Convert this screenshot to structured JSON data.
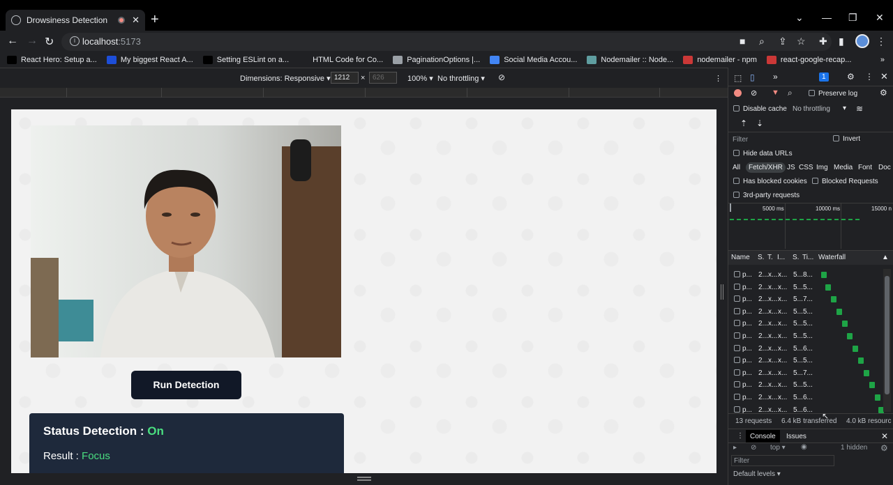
{
  "browser": {
    "tab_title": "Drowsiness Detection",
    "tab_close": "✕",
    "new_tab": "+",
    "window_controls": [
      "⌄",
      "—",
      "❐",
      "✕"
    ],
    "url_host": "localhost",
    "url_port": ":5173",
    "bookmarks": [
      {
        "label": "React Hero: Setup a...",
        "icon": "medium-icon",
        "color": "#000000"
      },
      {
        "label": "My biggest React A...",
        "icon": "dev-icon",
        "color": "#1d4ed8"
      },
      {
        "label": "Setting ESLint on a...",
        "icon": "medium-icon",
        "color": "#000000"
      },
      {
        "label": "HTML Code for Co...",
        "icon": "blank-icon",
        "color": "#202124"
      },
      {
        "label": "PaginationOptions |...",
        "icon": "globe-icon",
        "color": "#9aa0a6"
      },
      {
        "label": "Social Media Accou...",
        "icon": "docs-icon",
        "color": "#4285f4"
      },
      {
        "label": "Nodemailer :: Node...",
        "icon": "nodemailer-icon",
        "color": "#5f9ea0"
      },
      {
        "label": "nodemailer - npm",
        "icon": "npm-icon",
        "color": "#cb3837"
      },
      {
        "label": "react-google-recap...",
        "icon": "npm-icon",
        "color": "#cb3837"
      }
    ],
    "bookmarks_overflow": "»"
  },
  "device_toolbar": {
    "dimensions_label": "Dimensions: Responsive ▾",
    "width": "1212",
    "times": "×",
    "height": "626",
    "zoom": "100% ▾",
    "throttling": "No throttling ▾",
    "more": "⋮"
  },
  "app": {
    "run_button": "Run Detection",
    "status_label": "Status Detection : ",
    "status_value": "On",
    "result_label": "Result : ",
    "result_value": "Focus",
    "accent": "#4ade80"
  },
  "devtools": {
    "issues_badge": "1",
    "preserve_log": "Preserve log",
    "disable_cache": "Disable cache",
    "throttling": "No throttling",
    "filter_placeholder": "Filter",
    "invert": "Invert",
    "hide_data_urls": "Hide data URLs",
    "type_filters": [
      "All",
      "Fetch/XHR",
      "JS",
      "CSS",
      "Img",
      "Media",
      "Font",
      "Doc"
    ],
    "active_filter": "Fetch/XHR",
    "has_blocked_cookies": "Has blocked cookies",
    "blocked_requests": "Blocked Requests",
    "third_party": "3rd-party requests",
    "timeline_ticks": [
      "5000 ms",
      "10000 ms",
      "15000 n"
    ],
    "columns": [
      "Name",
      "S.",
      "T.",
      "I...",
      "S.",
      "Ti...",
      "Waterfall"
    ],
    "rows": [
      {
        "name": "p...",
        "s": "2...",
        "t": "x...",
        "i": "x...",
        "size": "5...",
        "time": "8...",
        "wf": 0.02
      },
      {
        "name": "p...",
        "s": "2...",
        "t": "x...",
        "i": "x...",
        "size": "5...",
        "time": "5...",
        "wf": 0.1
      },
      {
        "name": "p...",
        "s": "2...",
        "t": "x...",
        "i": "x...",
        "size": "5...",
        "time": "7...",
        "wf": 0.19
      },
      {
        "name": "p...",
        "s": "2...",
        "t": "x...",
        "i": "x...",
        "size": "5...",
        "time": "5...",
        "wf": 0.29
      },
      {
        "name": "p...",
        "s": "2...",
        "t": "x...",
        "i": "x...",
        "size": "5...",
        "time": "5...",
        "wf": 0.38
      },
      {
        "name": "p...",
        "s": "2...",
        "t": "x...",
        "i": "x...",
        "size": "5...",
        "time": "5...",
        "wf": 0.47
      },
      {
        "name": "p...",
        "s": "2...",
        "t": "x...",
        "i": "x...",
        "size": "5...",
        "time": "6...",
        "wf": 0.56
      },
      {
        "name": "p...",
        "s": "2...",
        "t": "x...",
        "i": "x...",
        "size": "5...",
        "time": "5...",
        "wf": 0.66
      },
      {
        "name": "p...",
        "s": "2...",
        "t": "x...",
        "i": "x...",
        "size": "5...",
        "time": "7...",
        "wf": 0.75
      },
      {
        "name": "p...",
        "s": "2...",
        "t": "x...",
        "i": "x...",
        "size": "5...",
        "time": "5...",
        "wf": 0.85
      },
      {
        "name": "p...",
        "s": "2...",
        "t": "x...",
        "i": "x...",
        "size": "5...",
        "time": "6...",
        "wf": 0.94
      },
      {
        "name": "p...",
        "s": "2...",
        "t": "x...",
        "i": "x...",
        "size": "5...",
        "time": "6...",
        "wf": 1.0
      }
    ],
    "summary_requests": "13 requests",
    "summary_transferred": "6.4 kB transferred",
    "summary_resources": "4.0 kB resourc",
    "drawer_tabs": [
      "Console",
      "Issues"
    ],
    "console_context": "top ▾",
    "hidden_count": "1 hidden",
    "console_filter_placeholder": "Filter",
    "default_levels": "Default levels ▾"
  }
}
